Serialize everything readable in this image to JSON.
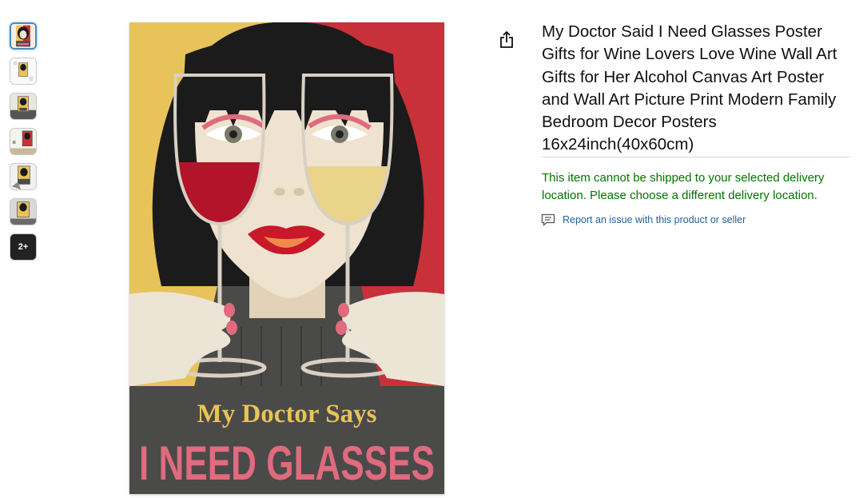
{
  "thumbnails": {
    "items": [
      {
        "name": "thumb-1",
        "selected": true
      },
      {
        "name": "thumb-2",
        "selected": false
      },
      {
        "name": "thumb-3",
        "selected": false
      },
      {
        "name": "thumb-4",
        "selected": false
      },
      {
        "name": "thumb-5",
        "selected": false
      },
      {
        "name": "thumb-6",
        "selected": false
      }
    ],
    "more_label": "2+"
  },
  "poster": {
    "line1": "My Doctor Says",
    "line2": "I NEED GLASSES"
  },
  "share_icon": "share-icon",
  "product": {
    "title": "My Doctor Said I Need Glasses Poster Gifts for Wine Lovers Love Wine Wall Art Gifts for Her Alcohol Canvas Art Poster and Wall Art Picture Print Modern Family Bedroom Decor Posters 16x24inch(40x60cm)",
    "shipping_message": "This item cannot be shipped to your selected delivery location. Please choose a different delivery location.",
    "report_link": "Report an issue with this product or seller"
  },
  "colors": {
    "shipping_text": "#007600",
    "link": "#2162a1",
    "poster_yellow": "#e8c35a",
    "poster_red": "#c8303a",
    "poster_pink": "#e06a7e"
  }
}
